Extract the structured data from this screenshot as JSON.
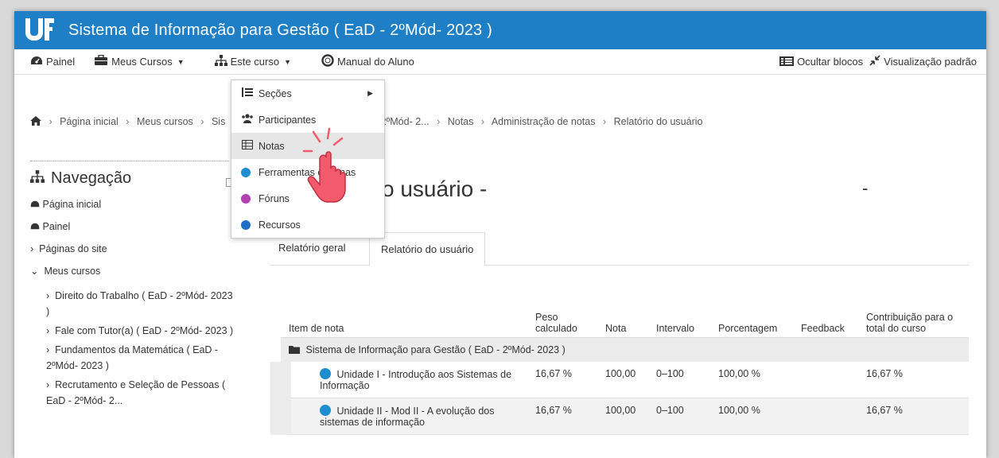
{
  "header": {
    "title": "Sistema de Informação para Gestão ( EaD - 2ºMód- 2023 )"
  },
  "navbar": {
    "painel": "Painel",
    "meus_cursos": "Meus Cursos",
    "este_curso": "Este curso",
    "manual": "Manual do Aluno",
    "ocultar_blocos": "Ocultar blocos",
    "visualizacao": "Visualização padrão"
  },
  "dropdown": {
    "items": [
      "Seções",
      "Participantes",
      "Notas",
      "Ferramentas externas",
      "Fóruns",
      "Recursos"
    ]
  },
  "breadcrumb": {
    "items": [
      "Página inicial",
      "Meus cursos",
      "Sis",
      "ão ( EaD - 2ºMód- 2...",
      "Notas",
      "Administração de notas",
      "Relatório do usuário"
    ]
  },
  "navigation": {
    "title": "Navegação",
    "home": "Página inicial",
    "painel": "Painel",
    "paginas_site": "Páginas do site",
    "meus_cursos": "Meus cursos",
    "courses": [
      "Direito do Trabalho ( EaD - 2ºMód- 2023 )",
      "Fale com Tutor(a) ( EaD - 2ºMód- 2023 )",
      "Fundamentos da Matemática ( EaD - 2ºMód- 2023 )",
      "Recrutamento e Seleção de Pessoas ( EaD - 2ºMód- 2..."
    ]
  },
  "page": {
    "heading": "o usuário -",
    "dash": "-"
  },
  "tabs": [
    "Relatório geral",
    "Relatório do usuário"
  ],
  "table": {
    "headers": [
      "Item de nota",
      "Peso calculado",
      "Nota",
      "Intervalo",
      "Porcentagem",
      "Feedback",
      "Contribuição para o total do curso"
    ],
    "category": "Sistema de Informação para Gestão ( EaD - 2ºMód- 2023 )",
    "rows": [
      {
        "item": "Unidade I - Introdução aos Sistemas de Informação",
        "peso": "16,67 %",
        "nota": "100,00",
        "intervalo": "0–100",
        "porcentagem": "100,00 %",
        "feedback": "",
        "contribuicao": "16,67 %"
      },
      {
        "item": "Unidade II - Mod II - A evolução dos sistemas de informação",
        "peso": "16,67 %",
        "nota": "100,00",
        "intervalo": "0–100",
        "porcentagem": "100,00 %",
        "feedback": "",
        "contribuicao": "16,67 %"
      }
    ]
  },
  "colors": {
    "brand": "#1f7fc6",
    "external_tool": "#1f8ecf",
    "forum": "#b340b3",
    "resource": "#1f6fc6",
    "cursor": "#f25b6b"
  }
}
